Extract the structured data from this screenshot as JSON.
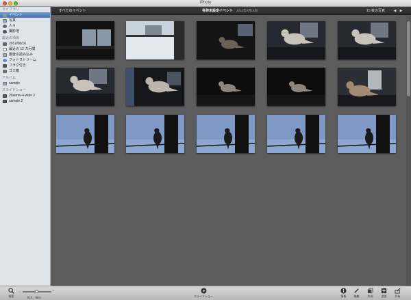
{
  "window": {
    "title": "iPhoto"
  },
  "sidebar": {
    "library_header": "ライブラリ",
    "library_items": [
      {
        "label": "イベント",
        "icon": "events-icon",
        "selected": true
      },
      {
        "label": "写真",
        "icon": "photos-icon"
      },
      {
        "label": "人々",
        "icon": "faces-icon"
      },
      {
        "label": "撮影地",
        "icon": "places-icon"
      }
    ],
    "recent_header": "最近の項目",
    "recent_items": [
      {
        "label": "2012/08/16",
        "icon": "event-icon"
      },
      {
        "label": "最近の 12 カ月間",
        "icon": "calendar-icon"
      },
      {
        "label": "最後の読み込み",
        "icon": "import-icon"
      },
      {
        "label": "フォトストリーム",
        "icon": "photostream-icon"
      },
      {
        "label": "フラグ付き",
        "icon": "flag-icon"
      },
      {
        "label": "ゴミ箱",
        "icon": "trash-icon"
      }
    ],
    "albums_header": "アルバム",
    "album_items": [
      {
        "label": "sample",
        "icon": "album-icon"
      }
    ],
    "slideshow_header": "スライドショー",
    "slideshow_items": [
      {
        "label": "20anniv-4-wide 2",
        "icon": "slideshow-icon"
      },
      {
        "label": "sample 2",
        "icon": "slideshow-icon"
      }
    ]
  },
  "content": {
    "all_events_label": "すべてのイベント",
    "event_title": "名称未設定イベント",
    "event_date": "2012年8月16日",
    "photo_count": "15 枚の写真",
    "prev_label": "◀",
    "next_label": "▶"
  },
  "photos": [
    {
      "scene": "window-dark"
    },
    {
      "scene": "window-bright"
    },
    {
      "scene": "dove-dark-blur"
    },
    {
      "scene": "dove-window"
    },
    {
      "scene": "dove-window"
    },
    {
      "scene": "dove-window"
    },
    {
      "scene": "dove-window-dark"
    },
    {
      "scene": "dove-silhouette-dark"
    },
    {
      "scene": "dove-silhouette-dark"
    },
    {
      "scene": "dove-window-tan"
    },
    {
      "scene": "dove-wire-blue"
    },
    {
      "scene": "dove-wire-blue"
    },
    {
      "scene": "dove-wire-blue"
    },
    {
      "scene": "dove-wire-blue"
    },
    {
      "scene": "dove-wire-blue"
    }
  ],
  "toolbar": {
    "search_label": "検索",
    "zoom_label": "拡大／縮小",
    "slideshow_label": "スライドショー",
    "info_label": "情報",
    "edit_label": "編集",
    "create_label": "作成",
    "add_label": "追加",
    "share_label": "共有"
  }
}
